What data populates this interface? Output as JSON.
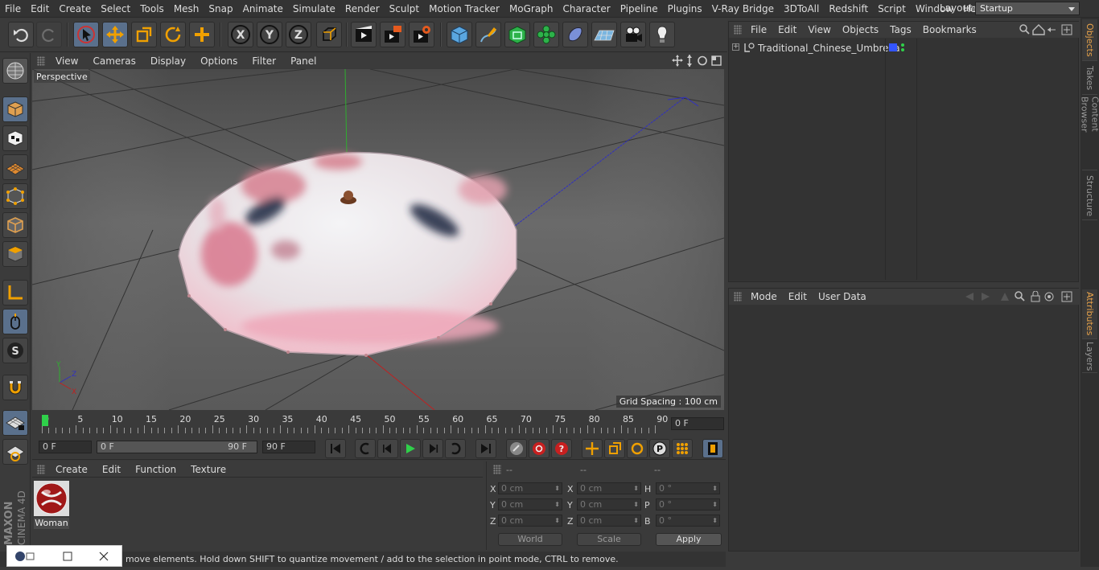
{
  "menubar": {
    "items": [
      "File",
      "Edit",
      "Create",
      "Select",
      "Tools",
      "Mesh",
      "Snap",
      "Animate",
      "Simulate",
      "Render",
      "Sculpt",
      "Motion Tracker",
      "MoGraph",
      "Character",
      "Pipeline",
      "Plugins",
      "V-Ray Bridge",
      "3DToAll",
      "Redshift",
      "Script",
      "Window",
      "Help"
    ],
    "layout_label": "Layout:",
    "layout_value": "Startup"
  },
  "toolbar": {
    "icons": [
      "undo-icon",
      "redo-icon",
      "live-selection-icon",
      "move-icon",
      "scale-icon",
      "rotate-icon",
      "create-multi-icon",
      "x-axis-icon",
      "y-axis-icon",
      "z-axis-icon",
      "coordinate-system-icon",
      "render-view-icon",
      "render-picture-viewer-icon",
      "render-settings-icon",
      "cube-icon",
      "pen-icon",
      "subdivision-icon",
      "cloner-icon",
      "deformer-icon",
      "floor-icon",
      "camera-icon",
      "light-icon"
    ],
    "x_label": "X",
    "y_label": "Y",
    "z_label": "Z"
  },
  "viewport": {
    "menu": [
      "View",
      "Cameras",
      "Display",
      "Options",
      "Filter",
      "Panel"
    ],
    "label": "Perspective",
    "grid_spacing": "Grid Spacing : 100 cm",
    "axis_y": "Y",
    "axis_z": "Z",
    "axis_x": "X"
  },
  "timeline": {
    "ticks": [
      "0",
      "5",
      "10",
      "15",
      "20",
      "25",
      "30",
      "35",
      "40",
      "45",
      "50",
      "55",
      "60",
      "65",
      "70",
      "75",
      "80",
      "85",
      "90"
    ],
    "current_frame": "0 F",
    "start_frame": "0 F",
    "range_start": "0 F",
    "range_end": "90 F",
    "end_frame": "90 F",
    "playhead_fraction": 0.0
  },
  "materials": {
    "menu": [
      "Create",
      "Edit",
      "Function",
      "Texture"
    ],
    "items": [
      {
        "name": "Woman"
      }
    ]
  },
  "coordinates": {
    "headers": [
      "--",
      "--",
      "--"
    ],
    "rows": [
      {
        "l1": "X",
        "v1": "0 cm",
        "l2": "X",
        "v2": "0 cm",
        "l3": "H",
        "v3": "0 °"
      },
      {
        "l1": "Y",
        "v1": "0 cm",
        "l2": "Y",
        "v2": "0 cm",
        "l3": "P",
        "v3": "0 °"
      },
      {
        "l1": "Z",
        "v1": "0 cm",
        "l2": "Z",
        "v2": "0 cm",
        "l3": "B",
        "v3": "0 °"
      }
    ],
    "world": "World",
    "scale": "Scale",
    "apply": "Apply"
  },
  "objects": {
    "menu": [
      "File",
      "Edit",
      "View",
      "Objects",
      "Tags",
      "Bookmarks"
    ],
    "items": [
      {
        "name": "Traditional_Chinese_Umbrella",
        "color": "#3355ff",
        "layer": "L0"
      }
    ]
  },
  "attributes": {
    "menu": [
      "Mode",
      "Edit",
      "User Data"
    ]
  },
  "sidetabs": {
    "top": [
      "Objects",
      "Takes",
      "Content Browser",
      "Structure"
    ],
    "bottom": [
      "Attributes",
      "Layers"
    ]
  },
  "status": {
    "text": "move elements. Hold down SHIFT to quantize movement / add to the selection in point mode, CTRL to remove."
  },
  "brand": {
    "maxon": "MAXON",
    "product": "CINEMA 4D"
  },
  "colors": {
    "accent": "#5a708c",
    "active_tab": "#e8a34a",
    "green_axis": "#2fae2f",
    "red_axis": "#c02020",
    "blue_axis": "#3030c0"
  }
}
